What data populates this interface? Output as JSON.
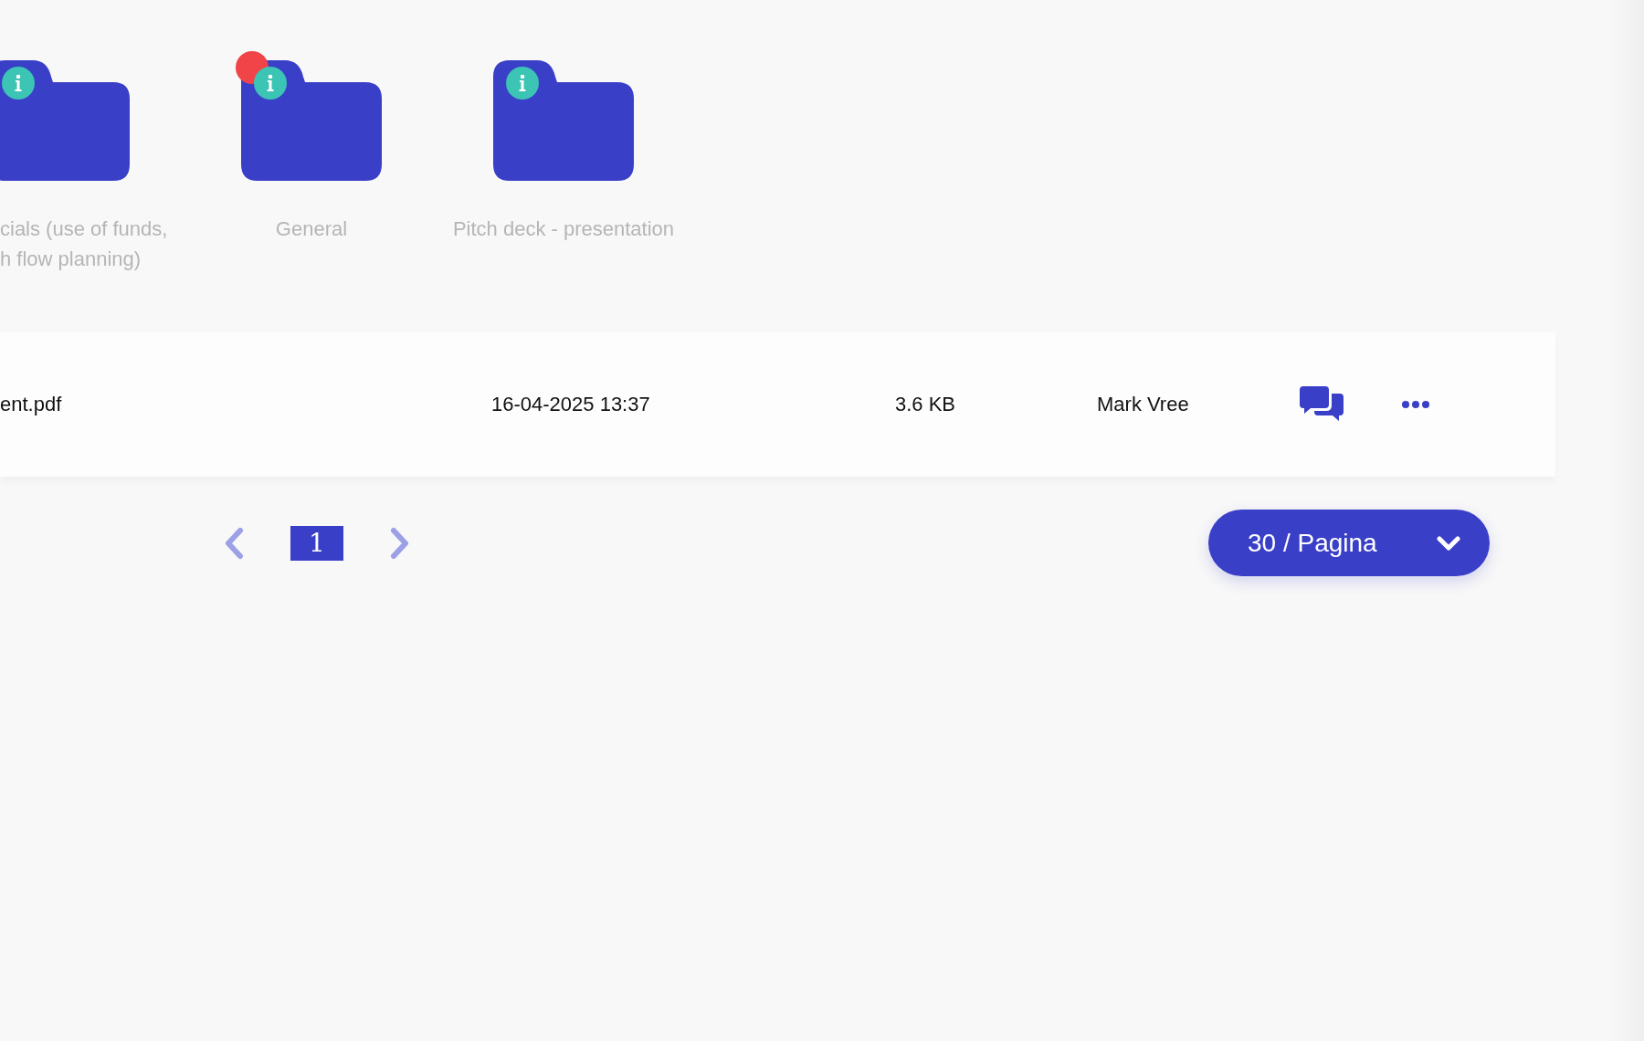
{
  "folders": [
    {
      "label_lines": [
        "cials (use of funds,",
        "h flow planning)"
      ],
      "clipped": true,
      "notification": false
    },
    {
      "label_lines": [
        "General"
      ],
      "clipped": false,
      "notification": true
    },
    {
      "label_lines": [
        "Pitch deck - presentation"
      ],
      "clipped": false,
      "notification": false
    }
  ],
  "file_row": {
    "name": "ent.pdf",
    "modified": "16-04-2025 13:37",
    "size": "3.6 KB",
    "owner": "Mark Vree"
  },
  "pagination": {
    "pages": [
      {
        "label": "1",
        "selected": true
      }
    ],
    "per_page": "30 / Pagina"
  }
}
